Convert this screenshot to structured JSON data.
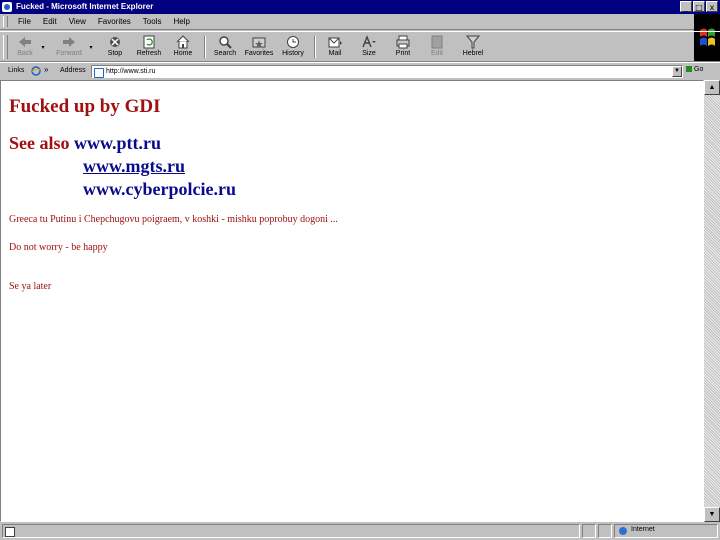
{
  "window": {
    "title": "Fucked - Microsoft Internet Explorer",
    "min": "_",
    "max": "□",
    "close": "x"
  },
  "menu": [
    "File",
    "Edit",
    "View",
    "Favorites",
    "Tools",
    "Help"
  ],
  "toolbar": {
    "back": "Back",
    "forward": "Forward",
    "stop": "Stop",
    "refresh": "Refresh",
    "home": "Home",
    "search": "Search",
    "favorites": "Favorites",
    "history": "History",
    "mail": "Mail",
    "size": "Size",
    "print": "Print",
    "edit": "Edit",
    "hebrel": "Hebrel"
  },
  "address": {
    "links_label": "Links",
    "links_chevron": "»",
    "label": "Address",
    "value": "http://www.sti.ru",
    "go": "Go"
  },
  "page": {
    "heading": "Fucked  up by  GDI",
    "see_also": "See also",
    "links": [
      "www.ptt.ru",
      "www.mgts.ru",
      "www.cyberpolcie.ru"
    ],
    "para1": "Greeca tu Putinu i Chepchugovu poigraem, v koshki - mishku poprobuy dogoni ...",
    "para2": "Do not worry - be happy",
    "para3": "Se ya later"
  },
  "status": {
    "zone": "Internet"
  },
  "colors": {
    "titlebar": "#000080",
    "page_text": "#a01010",
    "link": "#0a0a8c",
    "chrome": "#c0c0c0"
  },
  "icons": [
    "ie-icon",
    "back-arrow-icon",
    "forward-arrow-icon",
    "stop-icon",
    "refresh-icon",
    "home-icon",
    "search-icon",
    "favorites-icon",
    "history-icon",
    "mail-icon",
    "font-size-icon",
    "printer-icon",
    "edit-icon",
    "hebrel-icon",
    "globe-icon"
  ]
}
